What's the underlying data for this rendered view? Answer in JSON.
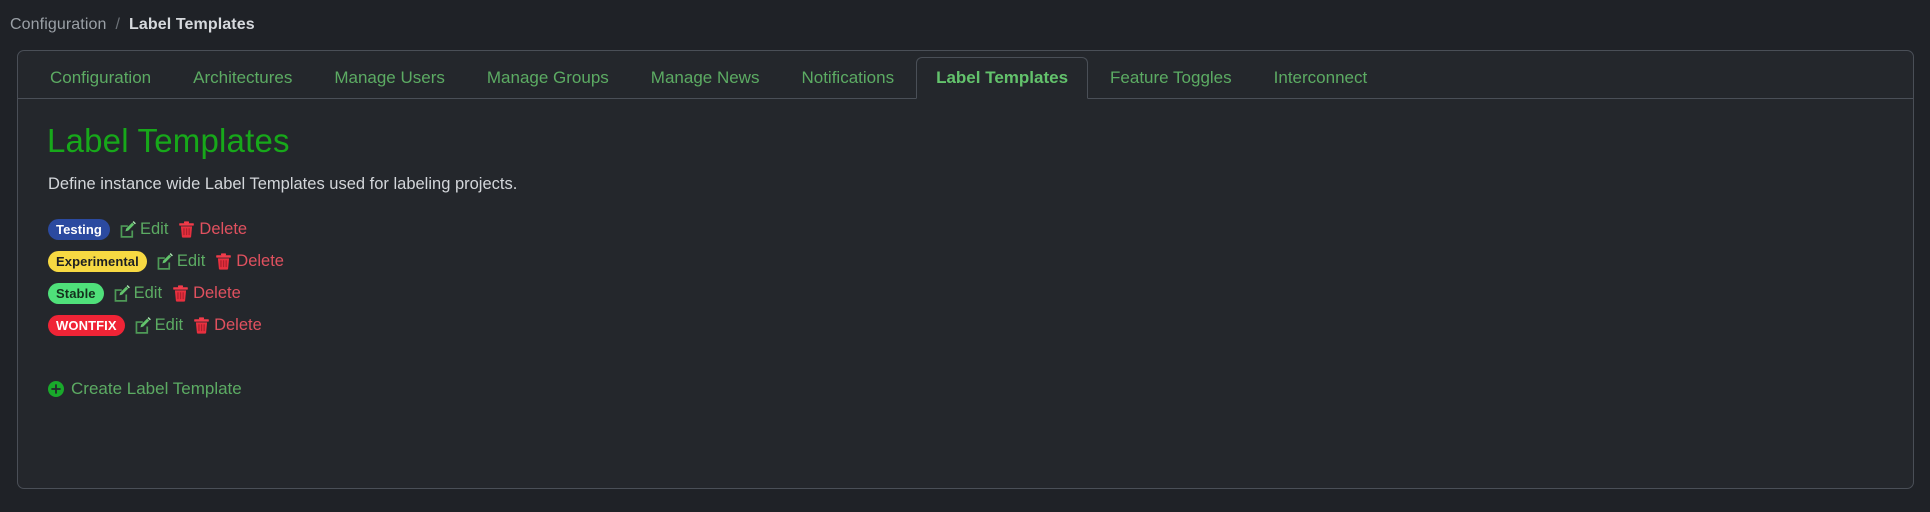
{
  "breadcrumb": {
    "parent": "Configuration",
    "separator": "/",
    "current": "Label Templates"
  },
  "tabs": [
    {
      "label": "Configuration",
      "active": false
    },
    {
      "label": "Architectures",
      "active": false
    },
    {
      "label": "Manage Users",
      "active": false
    },
    {
      "label": "Manage Groups",
      "active": false
    },
    {
      "label": "Manage News",
      "active": false
    },
    {
      "label": "Notifications",
      "active": false
    },
    {
      "label": "Label Templates",
      "active": true
    },
    {
      "label": "Feature Toggles",
      "active": false
    },
    {
      "label": "Interconnect",
      "active": false
    }
  ],
  "main": {
    "title": "Label Templates",
    "description": "Define instance wide Label Templates used for labeling projects.",
    "edit_label": "Edit",
    "delete_label": "Delete",
    "edit_icon": "pencil-square-icon",
    "delete_icon": "trash-icon",
    "create_icon": "plus-circle-icon",
    "create_label": "Create Label Template",
    "labels": [
      {
        "name": "Testing",
        "style": "blue"
      },
      {
        "name": "Experimental",
        "style": "yellow"
      },
      {
        "name": "Stable",
        "style": "green"
      },
      {
        "name": "WONTFIX",
        "style": "red"
      }
    ]
  },
  "colors": {
    "page_background": "#1f2227",
    "panel_background": "#24272c",
    "panel_border": "#4a4f57",
    "accent_green": "#17a81a",
    "tab_green": "#5cab63",
    "delete_red": "#e0515f",
    "badge_blue": "#2b4aa0",
    "badge_yellow": "#f7d942",
    "badge_green": "#4fe07a",
    "badge_red": "#f02436"
  }
}
